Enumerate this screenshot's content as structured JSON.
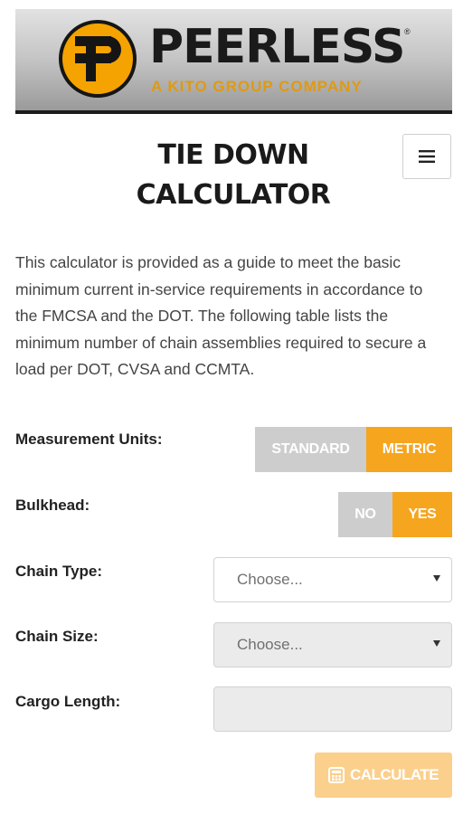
{
  "header": {
    "brand_name": "PEERLESS",
    "brand_mark": "®",
    "tagline": "A KITO GROUP COMPANY",
    "logo_icon": "peerless-p-logo-icon"
  },
  "page": {
    "title_line1": "TIE DOWN",
    "title_line2": "CALCULATOR",
    "menu_icon": "hamburger-menu-icon"
  },
  "intro": "This calculator is provided as a guide to meet the basic minimum current in-service requirements in accordance to the FMCSA and the DOT. The following table lists the minimum number of chain assemblies required to secure a load per DOT, CVSA and CCMTA.",
  "form": {
    "units": {
      "label": "Measurement Units:",
      "options": [
        "STANDARD",
        "METRIC"
      ],
      "selected": "METRIC"
    },
    "bulkhead": {
      "label": "Bulkhead:",
      "options": [
        "NO",
        "YES"
      ],
      "selected": "YES"
    },
    "chain_type": {
      "label": "Chain Type:",
      "value": "Choose..."
    },
    "chain_size": {
      "label": "Chain Size:",
      "value": "Choose..."
    },
    "cargo_length": {
      "label": "Cargo Length:",
      "value": ""
    },
    "calculate": {
      "label": "CALCULATE",
      "icon": "calculator-icon"
    }
  },
  "colors": {
    "accent": "#f6a51f",
    "toggle_off": "#cdcdcd",
    "button_disabled": "#fbd08c"
  }
}
